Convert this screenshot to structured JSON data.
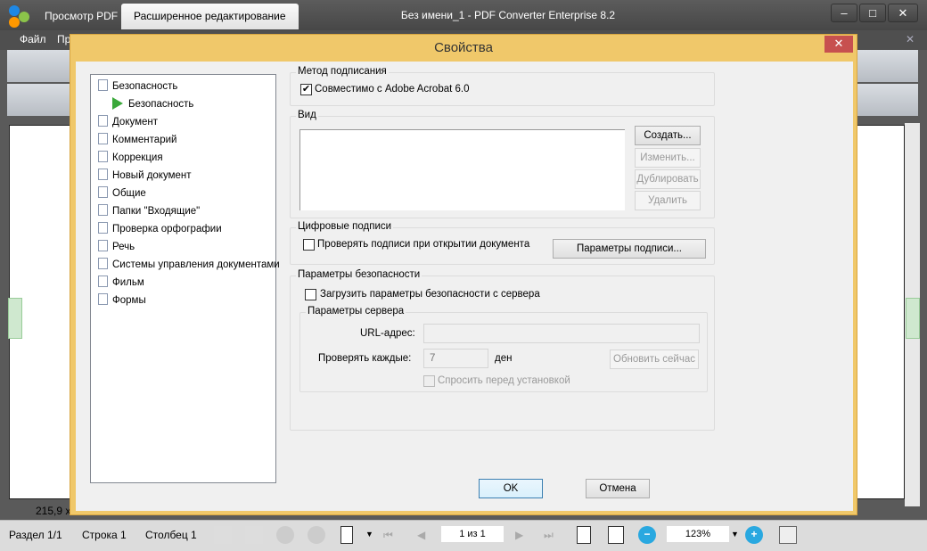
{
  "app": {
    "tabs": [
      "Просмотр PDF",
      "Расширенное редактирование"
    ],
    "window_title": "Без имени_1 - PDF Converter Enterprise 8.2",
    "menu": [
      "Файл",
      "Пр"
    ],
    "ruler_text": "215,9 x"
  },
  "statusbar": {
    "section": "Раздел 1/1",
    "row": "Строка 1",
    "column": "Столбец 1",
    "page": "1 из 1",
    "zoom": "123%"
  },
  "dialog": {
    "title": "Свойства",
    "tree": [
      {
        "label": "Безопасность",
        "level": 0
      },
      {
        "label": "Безопасность",
        "level": 1,
        "selected": true
      },
      {
        "label": "Документ",
        "level": 0
      },
      {
        "label": "Комментарий",
        "level": 0
      },
      {
        "label": "Коррекция",
        "level": 0
      },
      {
        "label": "Новый документ",
        "level": 0
      },
      {
        "label": "Общие",
        "level": 0
      },
      {
        "label": "Папки \"Входящие\"",
        "level": 0
      },
      {
        "label": "Проверка орфографии",
        "level": 0
      },
      {
        "label": "Речь",
        "level": 0
      },
      {
        "label": "Системы управления документами",
        "level": 0
      },
      {
        "label": "Фильм",
        "level": 0
      },
      {
        "label": "Формы",
        "level": 0
      }
    ],
    "signing": {
      "title": "Метод подписания",
      "compat_label": "Совместимо с Adobe Acrobat 6.0",
      "compat_checked": true
    },
    "view": {
      "title": "Вид",
      "create": "Создать...",
      "edit": "Изменить...",
      "duplicate": "Дублировать",
      "delete": "Удалить"
    },
    "digital": {
      "title": "Цифровые подписи",
      "verify_label": "Проверять подписи при открытии документа",
      "verify_checked": false,
      "params": "Параметры подписи..."
    },
    "security": {
      "title": "Параметры безопасности",
      "load_label": "Загрузить параметры безопасности с сервера",
      "load_checked": false,
      "server": {
        "title": "Параметры сервера",
        "url_label": "URL-адрес:",
        "url_value": "",
        "check_label": "Проверять каждые:",
        "check_value": "7",
        "unit": "ден",
        "update": "Обновить сейчас",
        "ask_label": "Спросить перед установкой"
      }
    },
    "ok": "OK",
    "cancel": "Отмена"
  }
}
